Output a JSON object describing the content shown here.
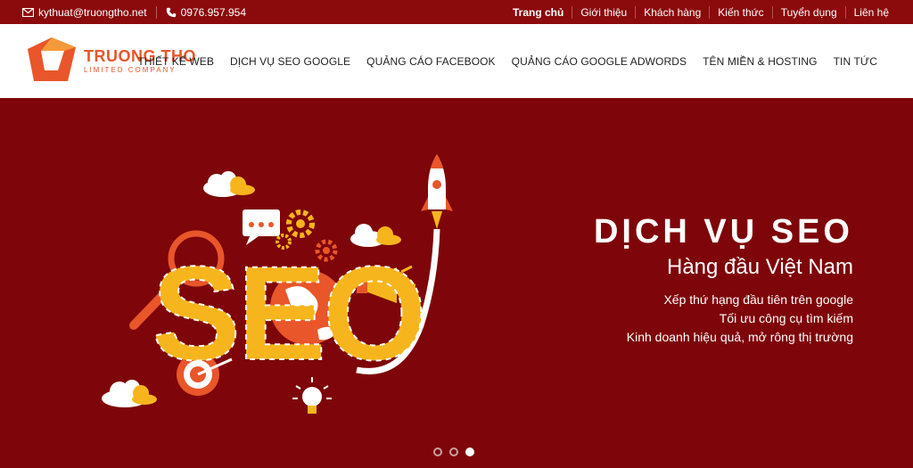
{
  "topbar": {
    "email": "kythuat@truongtho.net",
    "phone": "0976.957.954",
    "links": [
      "Trang chủ",
      "Giới thiệu",
      "Khách hàng",
      "Kiến thức",
      "Tuyển dụng",
      "Liên hệ"
    ]
  },
  "logo": {
    "name": "TRUONG THO",
    "tagline": "LIMITED COMPANY"
  },
  "nav": [
    "THIẾT KẾ WEB",
    "DỊCH VỤ SEO GOOGLE",
    "QUẢNG CÁO FACEBOOK",
    "QUẢNG CÁO GOOGLE ADWORDS",
    "TÊN MIỀN & HOSTING",
    "TIN TỨC"
  ],
  "hero": {
    "title": "DỊCH VỤ SEO",
    "subtitle": "Hàng đầu Việt Nam",
    "lines": [
      "Xếp thứ hạng đầu tiên trên google",
      "Tối ưu công cụ tìm kiếm",
      "Kinh doanh hiệu quả, mở rông thị trường"
    ],
    "illustration_text": "SEO"
  },
  "slider": {
    "count": 3,
    "active_index": 2
  },
  "colors": {
    "brand_red": "#8b0a0c",
    "hero_bg": "#7e0509",
    "logo_orange": "#e8562a",
    "seo_yellow": "#f7b51d"
  }
}
